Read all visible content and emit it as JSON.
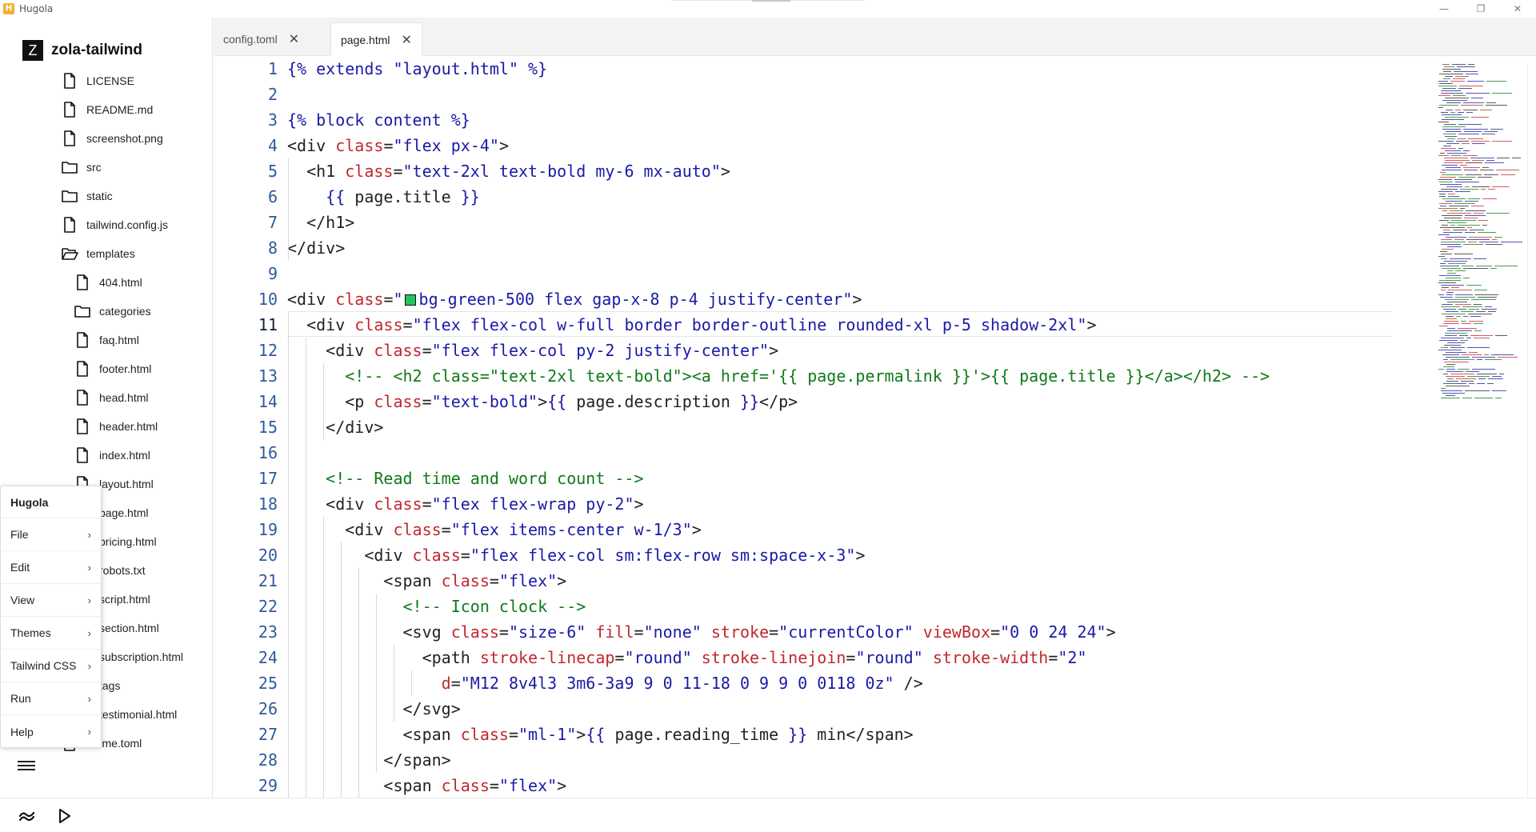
{
  "window": {
    "title": "Hugola",
    "logo": "H",
    "controls": {
      "minimize": "—",
      "restore": "❐",
      "close": "✕"
    }
  },
  "sidebar": {
    "project_logo": "Z",
    "project_name": "zola-tailwind",
    "items": [
      {
        "label": "LICENSE",
        "type": "file",
        "depth": 0
      },
      {
        "label": "README.md",
        "type": "file",
        "depth": 0
      },
      {
        "label": "screenshot.png",
        "type": "file",
        "depth": 0
      },
      {
        "label": "src",
        "type": "folder",
        "depth": 0
      },
      {
        "label": "static",
        "type": "folder",
        "depth": 0
      },
      {
        "label": "tailwind.config.js",
        "type": "file",
        "depth": 0
      },
      {
        "label": "templates",
        "type": "folder-open",
        "depth": 0
      },
      {
        "label": "404.html",
        "type": "file",
        "depth": 1
      },
      {
        "label": "categories",
        "type": "folder",
        "depth": 1
      },
      {
        "label": "faq.html",
        "type": "file",
        "depth": 1
      },
      {
        "label": "footer.html",
        "type": "file",
        "depth": 1
      },
      {
        "label": "head.html",
        "type": "file",
        "depth": 1
      },
      {
        "label": "header.html",
        "type": "file",
        "depth": 1
      },
      {
        "label": "index.html",
        "type": "file",
        "depth": 1
      },
      {
        "label": "layout.html",
        "type": "file",
        "depth": 1
      },
      {
        "label": "page.html",
        "type": "file",
        "depth": 1
      },
      {
        "label": "pricing.html",
        "type": "file",
        "depth": 1
      },
      {
        "label": "robots.txt",
        "type": "file",
        "depth": 1
      },
      {
        "label": "script.html",
        "type": "file",
        "depth": 1
      },
      {
        "label": "section.html",
        "type": "file",
        "depth": 1
      },
      {
        "label": "subscription.html",
        "type": "file",
        "depth": 1
      },
      {
        "label": "tags",
        "type": "folder",
        "depth": 1
      },
      {
        "label": "testimonial.html",
        "type": "file",
        "depth": 1
      },
      {
        "label": "theme.toml",
        "type": "file",
        "depth": 0
      }
    ]
  },
  "menu": {
    "title": "Hugola",
    "items": [
      {
        "label": "File"
      },
      {
        "label": "Edit"
      },
      {
        "label": "View"
      },
      {
        "label": "Themes"
      },
      {
        "label": "Tailwind CSS"
      },
      {
        "label": "Run"
      },
      {
        "label": "Help"
      }
    ],
    "chevron": "›"
  },
  "tabs": [
    {
      "label": "config.toml",
      "active": false
    },
    {
      "label": "page.html",
      "active": true
    }
  ],
  "tab_close": "✕",
  "editor": {
    "current_line": 11,
    "lines": [
      [
        [
          "tpl",
          "{% extends \"layout.html\" %}"
        ]
      ],
      [],
      [
        [
          "tpl",
          "{% block content %}"
        ]
      ],
      [
        [
          "tag",
          "<div "
        ],
        [
          "attr",
          "class"
        ],
        [
          "tag",
          "="
        ],
        [
          "str",
          "\"flex px-4\""
        ],
        [
          "tag",
          ">"
        ]
      ],
      [
        [
          "tag",
          "  <h1 "
        ],
        [
          "attr",
          "class"
        ],
        [
          "tag",
          "="
        ],
        [
          "str",
          "\"text-2xl text-bold my-6 mx-auto\""
        ],
        [
          "tag",
          ">"
        ]
      ],
      [
        [
          "tpl",
          "    {{ "
        ],
        [
          "tag",
          "page.title"
        ],
        [
          "tpl",
          " }}"
        ]
      ],
      [
        [
          "tag",
          "  </h1>"
        ]
      ],
      [
        [
          "tag",
          "</div>"
        ]
      ],
      [],
      [
        [
          "tag",
          "<div "
        ],
        [
          "attr",
          "class"
        ],
        [
          "tag",
          "="
        ],
        [
          "str",
          "\""
        ],
        [
          "swatch",
          ""
        ],
        [
          "str",
          "bg-green-500 flex gap-x-8 p-4 justify-center\""
        ],
        [
          "tag",
          ">"
        ]
      ],
      [
        [
          "tag",
          "  <div "
        ],
        [
          "attr",
          "class"
        ],
        [
          "tag",
          "="
        ],
        [
          "str",
          "\"flex flex-col w-full border border-outline rounded-xl p-5 shadow-2xl\""
        ],
        [
          "tag",
          ">"
        ]
      ],
      [
        [
          "tag",
          "    <div "
        ],
        [
          "attr",
          "class"
        ],
        [
          "tag",
          "="
        ],
        [
          "str",
          "\"flex flex-col py-2 justify-center\""
        ],
        [
          "tag",
          ">"
        ]
      ],
      [
        [
          "com",
          "      <!-- <h2 class=\"text-2xl text-bold\"><a href='{{ page.permalink }}'>{{ page.title }}</a></h2> -->"
        ]
      ],
      [
        [
          "tag",
          "      <p "
        ],
        [
          "attr",
          "class"
        ],
        [
          "tag",
          "="
        ],
        [
          "str",
          "\"text-bold\""
        ],
        [
          "tag",
          ">"
        ],
        [
          "tpl",
          "{{ "
        ],
        [
          "tag",
          "page.description"
        ],
        [
          "tpl",
          " }}"
        ],
        [
          "tag",
          "</p>"
        ]
      ],
      [
        [
          "tag",
          "    </div>"
        ]
      ],
      [],
      [
        [
          "com",
          "    <!-- Read time and word count -->"
        ]
      ],
      [
        [
          "tag",
          "    <div "
        ],
        [
          "attr",
          "class"
        ],
        [
          "tag",
          "="
        ],
        [
          "str",
          "\"flex flex-wrap py-2\""
        ],
        [
          "tag",
          ">"
        ]
      ],
      [
        [
          "tag",
          "      <div "
        ],
        [
          "attr",
          "class"
        ],
        [
          "tag",
          "="
        ],
        [
          "str",
          "\"flex items-center w-1/3\""
        ],
        [
          "tag",
          ">"
        ]
      ],
      [
        [
          "tag",
          "        <div "
        ],
        [
          "attr",
          "class"
        ],
        [
          "tag",
          "="
        ],
        [
          "str",
          "\"flex flex-col sm:flex-row sm:space-x-3\""
        ],
        [
          "tag",
          ">"
        ]
      ],
      [
        [
          "tag",
          "          <span "
        ],
        [
          "attr",
          "class"
        ],
        [
          "tag",
          "="
        ],
        [
          "str",
          "\"flex\""
        ],
        [
          "tag",
          ">"
        ]
      ],
      [
        [
          "com",
          "            <!-- Icon clock -->"
        ]
      ],
      [
        [
          "tag",
          "            <svg "
        ],
        [
          "attr",
          "class"
        ],
        [
          "tag",
          "="
        ],
        [
          "str",
          "\"size-6\""
        ],
        [
          "tag",
          " "
        ],
        [
          "attr",
          "fill"
        ],
        [
          "tag",
          "="
        ],
        [
          "str",
          "\"none\""
        ],
        [
          "tag",
          " "
        ],
        [
          "attr",
          "stroke"
        ],
        [
          "tag",
          "="
        ],
        [
          "str",
          "\"currentColor\""
        ],
        [
          "tag",
          " "
        ],
        [
          "attr",
          "viewBox"
        ],
        [
          "tag",
          "="
        ],
        [
          "str",
          "\"0 0 24 24\""
        ],
        [
          "tag",
          ">"
        ]
      ],
      [
        [
          "tag",
          "              <path "
        ],
        [
          "attr",
          "stroke-linecap"
        ],
        [
          "tag",
          "="
        ],
        [
          "str",
          "\"round\""
        ],
        [
          "tag",
          " "
        ],
        [
          "attr",
          "stroke-linejoin"
        ],
        [
          "tag",
          "="
        ],
        [
          "str",
          "\"round\""
        ],
        [
          "tag",
          " "
        ],
        [
          "attr",
          "stroke-width"
        ],
        [
          "tag",
          "="
        ],
        [
          "str",
          "\"2\""
        ]
      ],
      [
        [
          "tag",
          "                "
        ],
        [
          "attr",
          "d"
        ],
        [
          "tag",
          "="
        ],
        [
          "str",
          "\"M12 8v4l3 3m6-3a9 9 0 11-18 0 9 9 0 0118 0z\""
        ],
        [
          "tag",
          " />"
        ]
      ],
      [
        [
          "tag",
          "            </svg>"
        ]
      ],
      [
        [
          "tag",
          "            <span "
        ],
        [
          "attr",
          "class"
        ],
        [
          "tag",
          "="
        ],
        [
          "str",
          "\"ml-1\""
        ],
        [
          "tag",
          ">"
        ],
        [
          "tpl",
          "{{ "
        ],
        [
          "tag",
          "page.reading_time"
        ],
        [
          "tpl",
          " }}"
        ],
        [
          "tag",
          " min</span>"
        ]
      ],
      [
        [
          "tag",
          "          </span>"
        ]
      ],
      [
        [
          "tag",
          "          <span "
        ],
        [
          "attr",
          "class"
        ],
        [
          "tag",
          "="
        ],
        [
          "str",
          "\"flex\""
        ],
        [
          "tag",
          ">"
        ]
      ]
    ]
  },
  "colors": {
    "tag": "#222222",
    "attribute": "#c1272d",
    "string": "#1a1aa6",
    "comment": "#0f7a1a",
    "line_number": "#2f5a9c",
    "swatch": "#22c55e"
  },
  "status": {
    "icons": [
      "tailwind-icon",
      "run-icon"
    ]
  }
}
